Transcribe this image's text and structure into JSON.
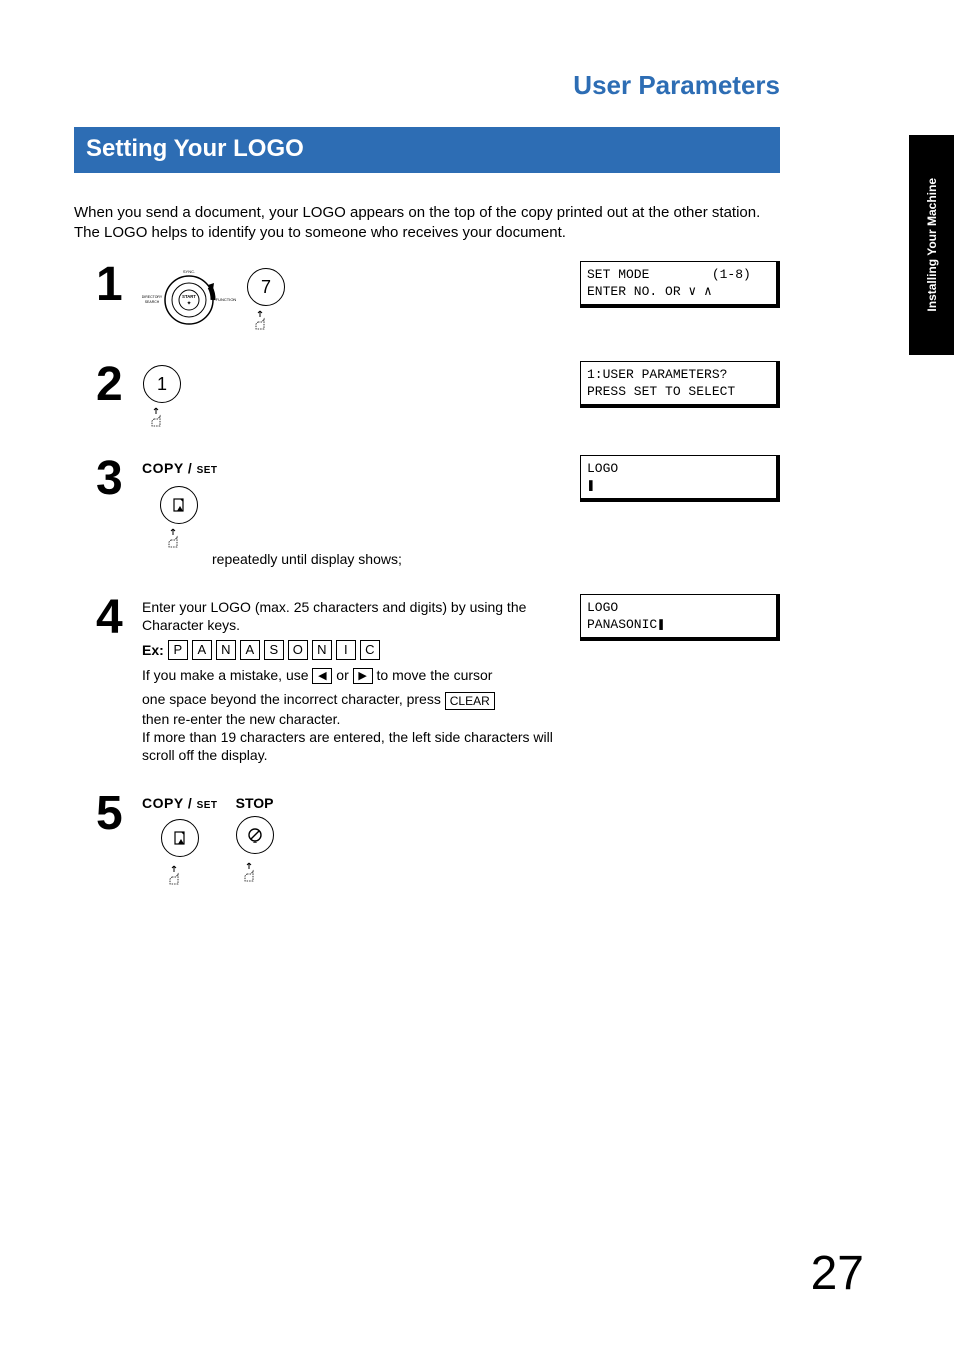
{
  "sideTab": "Installing Your\nMachine",
  "pageTitle": "User Parameters",
  "sectionTitle": "Setting Your LOGO",
  "intro": "When you send a document, your LOGO appears on the top of the copy printed out at the other station. The LOGO helps to identify you to someone who receives your document.",
  "steps": {
    "s1": {
      "num": "1",
      "keyLabel": "7",
      "lcd": "SET MODE        (1-8)\nENTER NO. OR ∨ ∧"
    },
    "s2": {
      "num": "2",
      "keyLabel": "1",
      "lcd": "1:USER PARAMETERS?\nPRESS SET TO SELECT"
    },
    "s3": {
      "num": "3",
      "copySet": "COPY /",
      "setSmall": "SET",
      "tail": "repeatedly until display shows;",
      "lcd": "LOGO\n❚"
    },
    "s4": {
      "num": "4",
      "line1": "Enter your LOGO (max. 25 characters and digits) by using the Character keys.",
      "exLabel": "Ex:",
      "exChars": [
        "P",
        "A",
        "N",
        "A",
        "S",
        "O",
        "N",
        "I",
        "C"
      ],
      "line2a": "If you make a mistake, use ",
      "line2b": " or ",
      "line2c": " to move the cursor",
      "line3a": "one space beyond the incorrect character, press ",
      "clear": "CLEAR",
      "line4": "then re-enter the new character.",
      "line5": "If more than 19 characters are entered, the left side characters will scroll off the display.",
      "lcd": "LOGO\nPANASONIC❚"
    },
    "s5": {
      "num": "5",
      "copySet": "COPY /",
      "setSmall": "SET",
      "stop": "STOP"
    }
  },
  "dial": {
    "left": "DIRECTORY\nSEARCH",
    "center": "START",
    "right": "FUNCTION",
    "top": "SYNC."
  },
  "pageNumber": "27"
}
